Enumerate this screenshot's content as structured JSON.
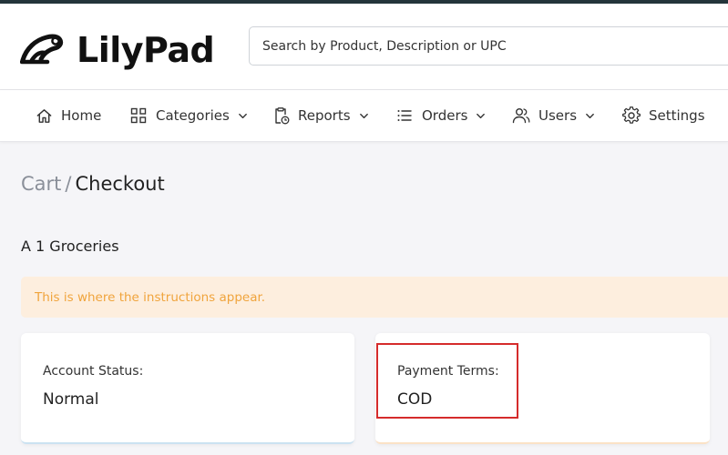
{
  "brand": {
    "name": "LilyPad"
  },
  "search": {
    "placeholder": "Search by Product, Description or UPC"
  },
  "nav": {
    "home": "Home",
    "categories": "Categories",
    "reports": "Reports",
    "orders": "Orders",
    "users": "Users",
    "settings": "Settings"
  },
  "breadcrumb": {
    "parent": "Cart",
    "separator": "/",
    "current": "Checkout"
  },
  "store": {
    "name": "A 1 Groceries"
  },
  "alert": {
    "text": "This is where the instructions appear."
  },
  "cards": {
    "account_status": {
      "label": "Account Status:",
      "value": "Normal"
    },
    "payment_terms": {
      "label": "Payment Terms:",
      "value": "COD"
    }
  },
  "colors": {
    "topbar": "#24353b",
    "alert_bg": "#fdeede",
    "alert_text": "#f0a43c",
    "highlight": "#d52b2b"
  },
  "icons": {
    "logo": "frog-logo-icon",
    "home": "home-icon",
    "categories": "grid-icon",
    "reports": "clipboard-clock-icon",
    "orders": "list-icon",
    "users": "users-icon",
    "settings": "gear-icon",
    "dropdown": "chevron-down-icon"
  }
}
